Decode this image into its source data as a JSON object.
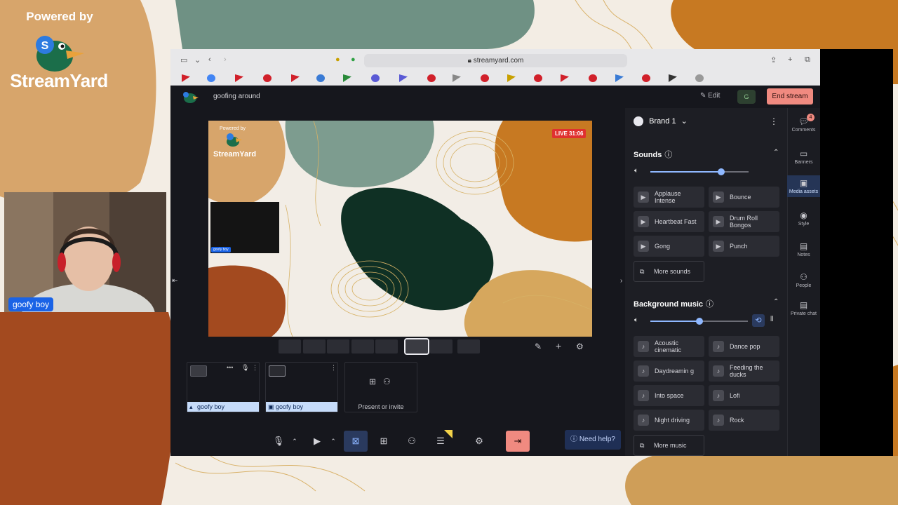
{
  "overlay": {
    "powered_by": "Powered by",
    "brand": "StreamYard",
    "cam_name": "goofy boy"
  },
  "browser": {
    "url": "streamyard.com"
  },
  "app": {
    "show_title": "goofing around",
    "edit_label": "Edit",
    "avatar_initials": "G",
    "end_stream_label": "End stream"
  },
  "stage": {
    "live_label": "LIVE 31:06",
    "powered_by": "Powered by",
    "brand": "StreamYard",
    "participant_label": "goofy boy"
  },
  "participants": [
    {
      "name": "goofy boy"
    },
    {
      "name": "goofy boy"
    }
  ],
  "present_invite_label": "Present or invite",
  "toolbar": {
    "help_label": "Need help?"
  },
  "panel": {
    "brand_name": "Brand 1",
    "sounds_title": "Sounds",
    "sounds": [
      {
        "label": "Applause Intense"
      },
      {
        "label": "Bounce"
      },
      {
        "label": "Heartbeat Fast"
      },
      {
        "label": "Drum Roll Bongos"
      },
      {
        "label": "Gong"
      },
      {
        "label": "Punch"
      }
    ],
    "more_sounds_label": "More sounds",
    "music_title": "Background music",
    "music": [
      {
        "label": "Acoustic cinematic"
      },
      {
        "label": "Dance pop"
      },
      {
        "label": "Daydreamin g"
      },
      {
        "label": "Feeding the ducks"
      },
      {
        "label": "Into space"
      },
      {
        "label": "Lofi"
      },
      {
        "label": "Night driving"
      },
      {
        "label": "Rock"
      }
    ],
    "more_music_label": "More music",
    "sounds_volume": 0.72,
    "music_volume": 0.5
  },
  "rail": [
    {
      "label": "Comments",
      "badge": "4"
    },
    {
      "label": "Banners"
    },
    {
      "label": "Media assets"
    },
    {
      "label": "Style"
    },
    {
      "label": "Notes"
    },
    {
      "label": "People"
    },
    {
      "label": "Private chat"
    }
  ],
  "colors": {
    "accent": "#1a63e6",
    "end_stream": "#f08a80",
    "live": "#e0312f",
    "panel_bg": "#1d1e24"
  }
}
